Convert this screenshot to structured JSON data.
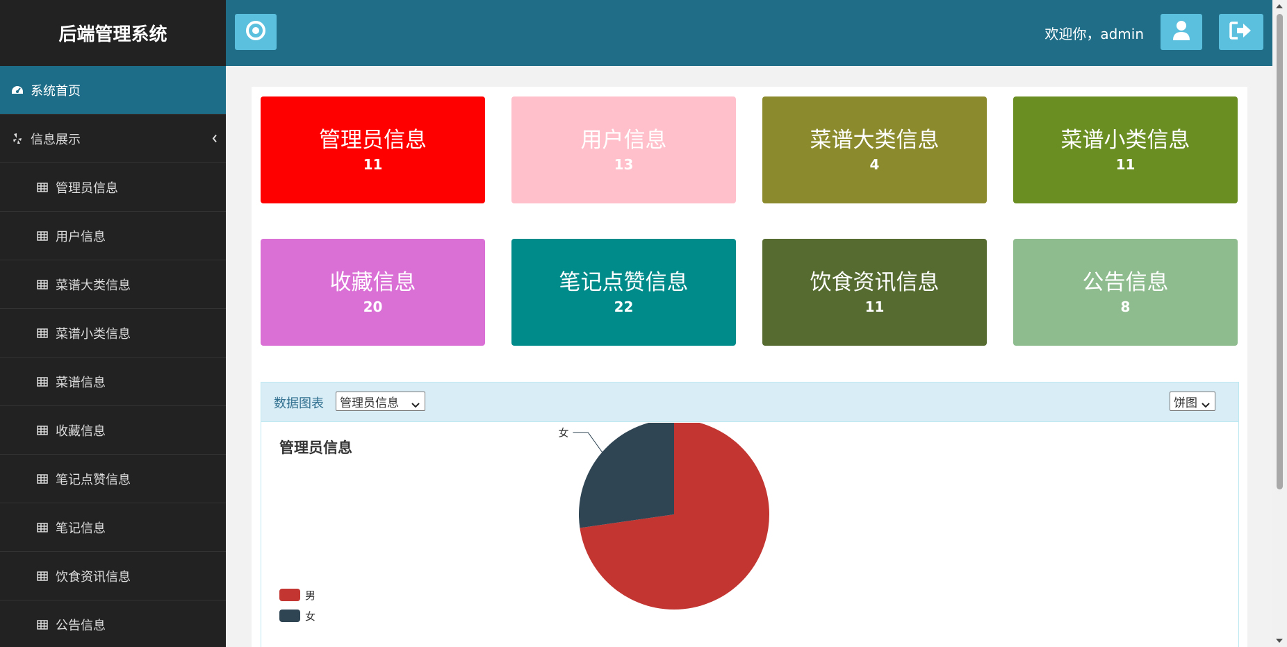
{
  "sidebar": {
    "brand": "后端管理系统",
    "home": "系统首页",
    "info": "信息展示",
    "items": [
      "管理员信息",
      "用户信息",
      "菜谱大类信息",
      "菜谱小类信息",
      "菜谱信息",
      "收藏信息",
      "笔记点赞信息",
      "笔记信息",
      "饮食资讯信息",
      "公告信息"
    ]
  },
  "topbar": {
    "welcome": "欢迎你，admin"
  },
  "cards": [
    {
      "title": "管理员信息",
      "count": "11",
      "color": "#ff0000"
    },
    {
      "title": "用户信息",
      "count": "13",
      "color": "#ffc0cb"
    },
    {
      "title": "菜谱大类信息",
      "count": "4",
      "color": "#8b8b2d"
    },
    {
      "title": "菜谱小类信息",
      "count": "11",
      "color": "#6b8e23"
    },
    {
      "title": "收藏信息",
      "count": "20",
      "color": "#da70d6"
    },
    {
      "title": "笔记点赞信息",
      "count": "22",
      "color": "#008b8b"
    },
    {
      "title": "饮食资讯信息",
      "count": "11",
      "color": "#556b2f"
    },
    {
      "title": "公告信息",
      "count": "8",
      "color": "#8fbc8f"
    }
  ],
  "panel": {
    "label": "数据图表",
    "table_select": "管理员信息",
    "chart_type_select": "饼图"
  },
  "chart_data": {
    "type": "pie",
    "title": "管理员信息",
    "legend_position": "left",
    "slices": [
      {
        "name": "男",
        "value": 8,
        "color": "#c23531"
      },
      {
        "name": "女",
        "value": 3,
        "color": "#2f4554"
      }
    ]
  }
}
